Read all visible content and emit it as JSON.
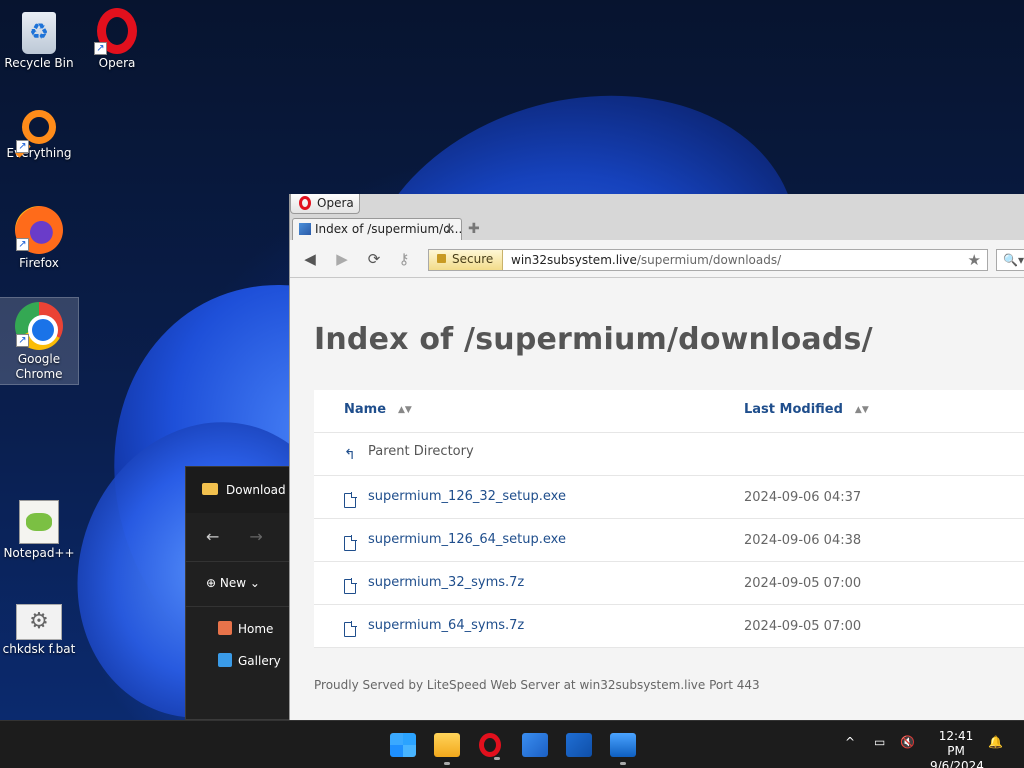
{
  "desktop": {
    "icons": [
      {
        "label": "Recycle Bin",
        "glyph": "♻"
      },
      {
        "label": "Opera"
      },
      {
        "label": "Everything"
      },
      {
        "label": "Firefox"
      },
      {
        "label": "Google Chrome"
      },
      {
        "label": "Notepad++"
      },
      {
        "label": "chkdsk f.bat",
        "glyph": "⚙"
      }
    ]
  },
  "explorer": {
    "title": "Download",
    "back": "←",
    "forward": "→",
    "new_label": "New",
    "sidebar": [
      "Home",
      "Gallery"
    ]
  },
  "opera": {
    "menu_label": "Opera",
    "tab": {
      "title": "Index of /supermium/d...",
      "close": "✕"
    },
    "newtab": "✚",
    "nav": {
      "back": "◀",
      "forward": "▶",
      "reload": "⟳",
      "key": "⚷"
    },
    "address": {
      "secure_label": "Secure",
      "domain": "win32subsystem.live",
      "path": "/supermium/downloads/",
      "star": "★"
    },
    "search_glyph": "🔍▾"
  },
  "page": {
    "heading": "Index of /supermium/downloads/",
    "columns": {
      "name": "Name",
      "modified": "Last Modified",
      "sort": "▲▼"
    },
    "parent_label": "Parent Directory",
    "parent_glyph": "↰",
    "files": [
      {
        "name": "supermium_126_32_setup.exe",
        "modified": "2024-09-06 04:37"
      },
      {
        "name": "supermium_126_64_setup.exe",
        "modified": "2024-09-06 04:38"
      },
      {
        "name": "supermium_32_syms.7z",
        "modified": "2024-09-05 07:00"
      },
      {
        "name": "supermium_64_syms.7z",
        "modified": "2024-09-05 07:00"
      }
    ],
    "footer": "Proudly Served by LiteSpeed Web Server at win32subsystem.live Port 443"
  },
  "taskbar": {
    "tray_chevron": "^",
    "tray_glyphs": {
      "network": "▭",
      "volume": "🔇",
      "bell": "🔔"
    },
    "time": "12:41 PM",
    "date": "9/6/2024"
  },
  "colors": {
    "link": "#1f4e8c",
    "opera_red": "#e2101d",
    "taskbar": "#1c1c1c"
  }
}
